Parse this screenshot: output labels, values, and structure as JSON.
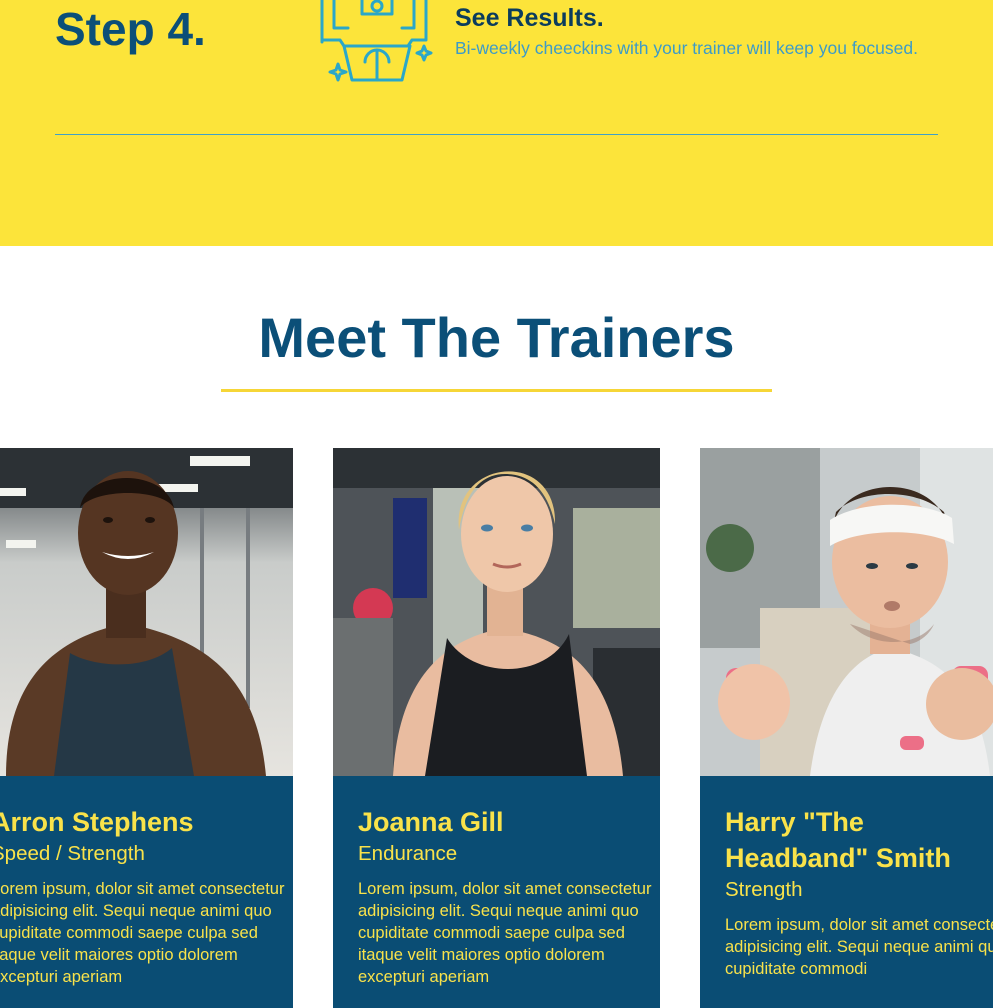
{
  "step": {
    "label": "Step 4.",
    "icon": "trainer-icon",
    "title": "See Results.",
    "description": "Bi-weekly cheeckins with your trainer will keep you focused."
  },
  "section": {
    "heading": "Meet The Trainers"
  },
  "trainers": [
    {
      "name": "Arron Stephens",
      "specialty": "Speed / Strength",
      "bio": "Lorem ipsum, dolor sit amet consectetur adipisicing elit. Sequi neque animi quo cupiditate commodi saepe culpa sed itaque velit maiores optio dolorem excepturi aperiam",
      "photo": "trainer-photo-man-tank-top"
    },
    {
      "name": "Joanna Gill",
      "specialty": "Endurance",
      "bio": "Lorem ipsum, dolor sit amet consectetur adipisicing elit. Sequi neque animi quo cupiditate commodi saepe culpa sed itaque velit maiores optio dolorem excepturi aperiam",
      "photo": "trainer-photo-woman-gym"
    },
    {
      "name": "Harry \"The Headband\" Smith",
      "specialty": "Strength",
      "bio": "Lorem ipsum, dolor sit amet consectetur adipisicing elit. Sequi neque animi quo cupiditate commodi",
      "photo": "trainer-photo-man-headband-dumbbells"
    }
  ],
  "colors": {
    "yellow": "#fce43a",
    "navy": "#0a4d74",
    "accent_text": "#f9e24a",
    "divider": "#3fa0c8"
  }
}
